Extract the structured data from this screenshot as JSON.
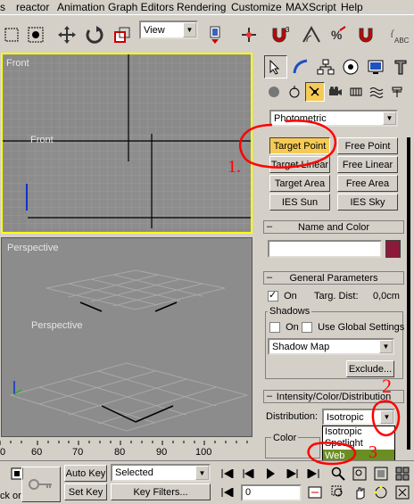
{
  "menu": [
    "s",
    "reactor",
    "Animation",
    "Graph Editors",
    "Rendering",
    "Customize",
    "MAXScript",
    "Help"
  ],
  "toolbar": {
    "view_combo": "View",
    "abc_label": "ABC"
  },
  "viewports": {
    "front_label": "Front",
    "front_inner_label": "Front",
    "persp_label": "Perspective",
    "persp_inner_label": "Perspective"
  },
  "panel": {
    "category_combo": "Photometric",
    "buttons": [
      "Target Point",
      "Free Point",
      "Target Linear",
      "Free Linear",
      "Target Area",
      "Free Area",
      "IES Sun",
      "IES Sky"
    ],
    "name_color_title": "Name and Color",
    "general_title": "General Parameters",
    "on_label": "On",
    "targ_dist_label": "Targ. Dist:",
    "targ_dist_value": "0,0cm",
    "shadows_label": "Shadows",
    "shadows_on_label": "On",
    "use_global_label": "Use Global Settings",
    "shadow_type": "Shadow Map",
    "exclude_label": "Exclude...",
    "intensity_title": "Intensity/Color/Distribution",
    "distribution_label": "Distribution:",
    "distribution_value": "Isotropic",
    "distribution_options": [
      "Isotropic",
      "Spotlight",
      "Web"
    ],
    "color_label": "Color"
  },
  "timeline": {
    "ticks": [
      "0",
      "60",
      "70",
      "80",
      "90",
      "100"
    ]
  },
  "bottom": {
    "auto_key": "Auto Key",
    "set_key": "Set Key",
    "selected": "Selected",
    "key_filters": "Key Filters...",
    "frame_value": "0",
    "left_text": "ck or"
  },
  "annotations": {
    "one": "1.",
    "two": "2",
    "three": "3"
  },
  "colors": {
    "active_button": "#f6cb55",
    "name_swatch": "#8b1a3a",
    "annotation": "#ff0000",
    "viewport_border": "#ffff00"
  }
}
